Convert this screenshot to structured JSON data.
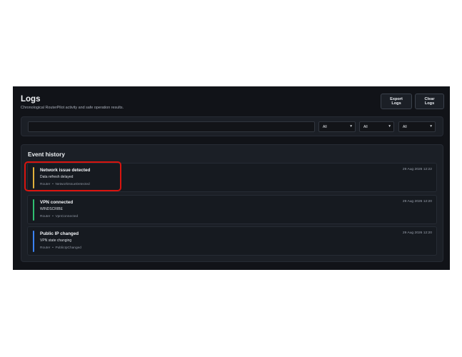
{
  "page": {
    "title": "Logs",
    "subtitle": "Chronological RouterPilot activity and safe operation results."
  },
  "toolbar": {
    "export_label": "Export Logs",
    "clear_label": "Clear Logs"
  },
  "filters": {
    "search_value": "",
    "selects": [
      {
        "value": "All"
      },
      {
        "value": "All"
      },
      {
        "value": "All"
      }
    ]
  },
  "history": {
    "title": "Event history",
    "events": [
      {
        "title": "Network issue detected",
        "detail": "Data refresh delayed",
        "source": "Router",
        "separator": "•",
        "type": "NetworkIssueDetected",
        "timestamp": "29 Aug 2026 12:22",
        "accent": "#e1b03c",
        "highlighted": true
      },
      {
        "title": "VPN connected",
        "detail": "WINDSCRIBE",
        "source": "Router",
        "separator": "•",
        "type": "VpnConnected",
        "timestamp": "29 Aug 2026 12:20",
        "accent": "#2fbf71"
      },
      {
        "title": "Public IP changed",
        "detail": "VPN state changing",
        "source": "Router",
        "separator": "•",
        "type": "PublicIpChanged",
        "timestamp": "29 Aug 2026 12:20",
        "accent": "#3b82f6"
      }
    ]
  },
  "colors": {
    "background": "#111318",
    "panel": "#1b1f26",
    "highlight_outline": "#d9140f"
  },
  "icons": {
    "select_chevron": "chevron-down-icon"
  }
}
